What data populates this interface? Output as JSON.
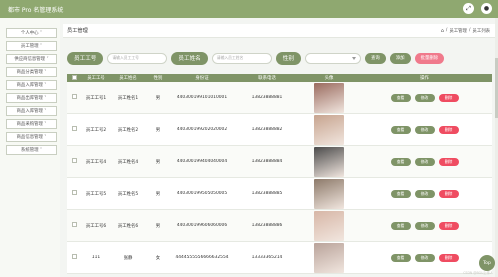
{
  "app": {
    "title": "都市 Pro 名管理系统"
  },
  "header": {
    "icons": [
      "expand-icon",
      "user-icon"
    ]
  },
  "sidebar": {
    "items": [
      {
        "label": "个人中心 ˅"
      },
      {
        "label": "员工管理 ˅"
      },
      {
        "label": "供应商信息管理 ˅"
      },
      {
        "label": "商品分类管理 ˅"
      },
      {
        "label": "商品入库管理 ˅"
      },
      {
        "label": "商品出库管理 ˅"
      },
      {
        "label": "商品入库管理 ˅"
      },
      {
        "label": "商品采购管理 ˅"
      },
      {
        "label": "商品信息管理 ˅"
      },
      {
        "label": "系统管理 ˅"
      }
    ]
  },
  "breadcrumb": {
    "title": "员工管理",
    "path": [
      "/",
      "员工管理",
      "/",
      "员工列表"
    ]
  },
  "search": {
    "label_no": "员工工号",
    "placeholder_no": "请输入员工工号",
    "label_name": "员工姓名",
    "placeholder_name": "请输入员工姓名",
    "label_sex": "性别",
    "btn_search": "查询",
    "btn_add": "添加",
    "btn_batch_delete": "批量删除"
  },
  "table": {
    "headers": [
      "",
      "员工工号",
      "员工姓名",
      "性别",
      "身份证",
      "联系电话",
      "头像",
      "操作"
    ],
    "rows": [
      {
        "no": "员工工号1",
        "name": "员工姓名1",
        "sex": "男",
        "id": "440300199101010001",
        "phone": "13823888881",
        "photo": "#9a6b5f"
      },
      {
        "no": "员工工号2",
        "name": "员工姓名2",
        "sex": "男",
        "id": "440300199202020002",
        "phone": "13823888882",
        "photo": "#c7a48f"
      },
      {
        "no": "员工工号4",
        "name": "员工姓名4",
        "sex": "男",
        "id": "440300199404040004",
        "phone": "13823888884",
        "photo": "#4b4b4b"
      },
      {
        "no": "员工工号5",
        "name": "员工姓名5",
        "sex": "男",
        "id": "440300199505050005",
        "phone": "13823888885",
        "photo": "#8d7a6a"
      },
      {
        "no": "员工工号6",
        "name": "员工姓名6",
        "sex": "男",
        "id": "440300199606060006",
        "phone": "13823888886",
        "photo": "#d7b6a6"
      },
      {
        "no": "111",
        "name": "张静",
        "sex": "女",
        "id": "4444555556666632554",
        "phone": "13333365214",
        "photo": "#b9a39a"
      }
    ],
    "ops": {
      "view": "查看",
      "edit": "修改",
      "delete": "删除"
    }
  },
  "floating": {
    "top": "Top",
    "watermark": "CSDN @BGU上传人"
  },
  "colors": {
    "header": "#8fa870",
    "accent": "#7f9467",
    "danger": "#ef4c61"
  }
}
